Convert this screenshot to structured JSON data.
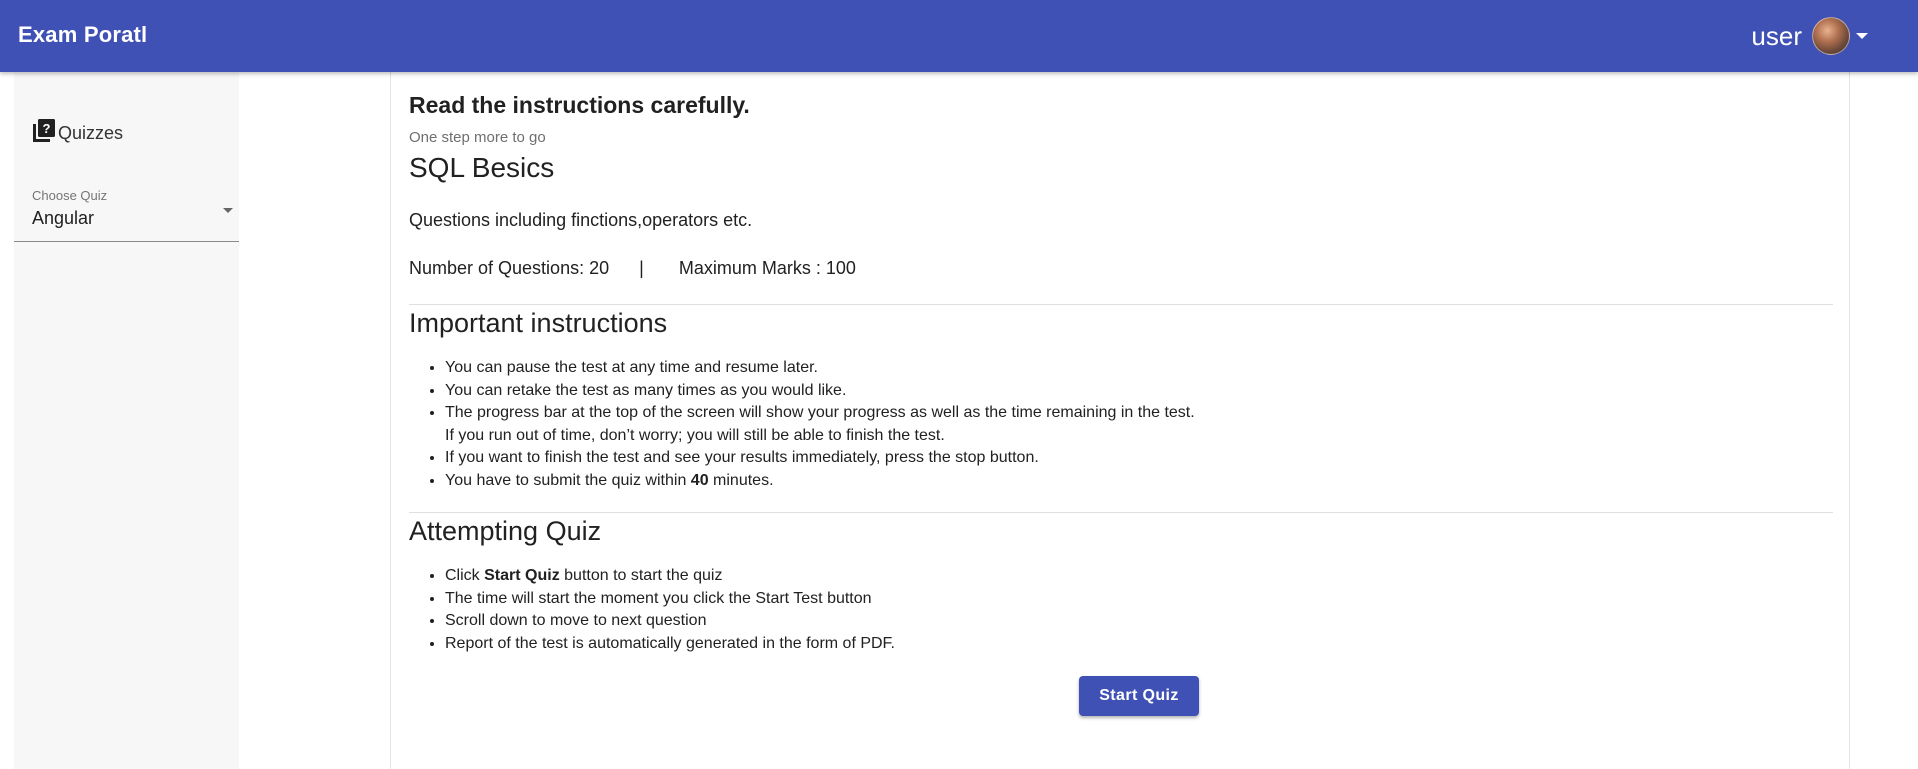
{
  "app": {
    "brand": "Exam Poratl",
    "user_name": "user",
    "accent_color": "#3f51b5"
  },
  "sidebar": {
    "item_label": "Quizzes",
    "item_icon": "quiz-library-icon",
    "select_label": "Choose Quiz",
    "select_value": "Angular"
  },
  "main": {
    "heading": "Read the instructions carefully.",
    "subheading": "One step more to go",
    "quiz_title": "SQL Besics",
    "description": "Questions including finctions,operators etc.",
    "num_questions_label": "Number of Questions: 20",
    "separator": "|",
    "max_marks_label": "Maximum Marks : 100",
    "important_title": "Important instructions",
    "important_items": [
      "You can pause the test at any time and resume later.",
      "You can retake the test as many times as you would like.",
      "The progress bar at the top of the screen will show your progress as well as the time remaining in the test.",
      "If you run out of time, don’t worry; you will still be able to finish the test.",
      "If you want to finish the test and see your results immediately, press the stop button.",
      "You have to submit the quiz within",
      "40",
      "minutes."
    ],
    "attempt_title": "Attempting Quiz",
    "attempt_items": [
      "Click",
      "Start Quiz",
      "button to start the quiz",
      "The time will start the moment you click the Start Test button",
      "Scroll down to move to next question",
      "Report of the test is automatically generated in the form of PDF."
    ],
    "start_button": "Start Quiz"
  }
}
